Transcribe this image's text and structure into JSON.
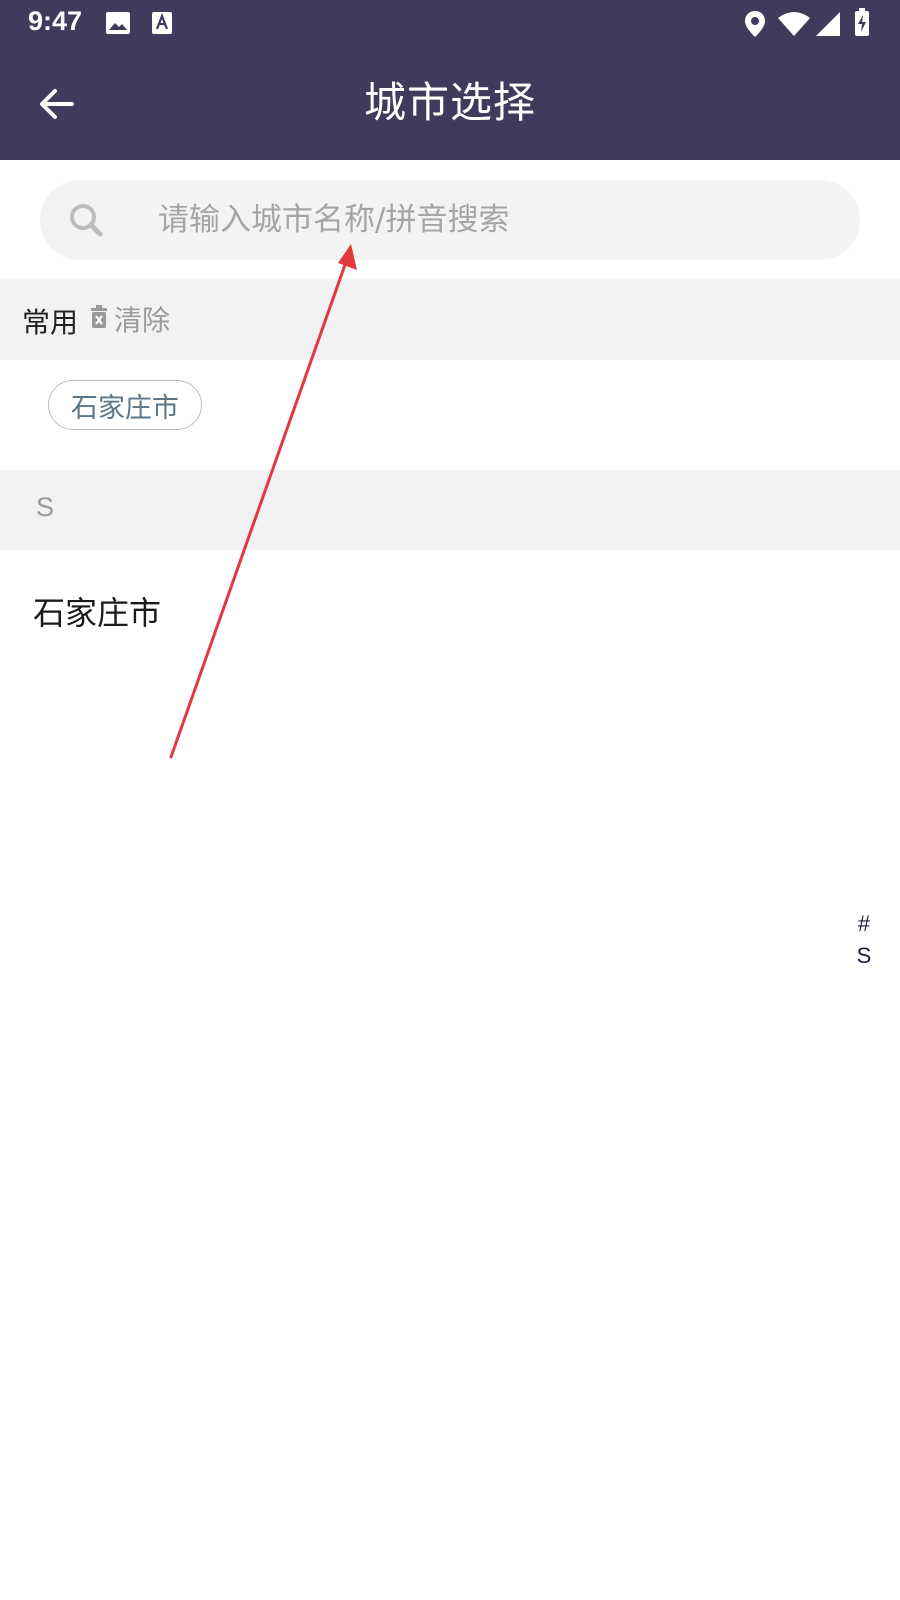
{
  "status_bar": {
    "time": "9:47",
    "left_icons": [
      "image-icon",
      "text-a-icon"
    ],
    "right_icons": [
      "location-icon",
      "wifi-icon",
      "signal-icon",
      "battery-charging-icon"
    ]
  },
  "app_bar": {
    "title": "城市选择",
    "back_icon": "arrow-left-icon"
  },
  "search": {
    "placeholder": "请输入城市名称/拼音搜索",
    "value": ""
  },
  "common_section": {
    "label": "常用",
    "clear_label": "清除",
    "chips": [
      "石家庄市"
    ]
  },
  "city_list": {
    "sections": [
      {
        "letter": "S",
        "cities": [
          "石家庄市"
        ]
      }
    ]
  },
  "index_bar": [
    "#",
    "S"
  ],
  "colors": {
    "primary": "#413b5b",
    "chip_text": "#5d7687",
    "section_bg": "#f2f2f2",
    "annotation_arrow": "#e0393e"
  }
}
